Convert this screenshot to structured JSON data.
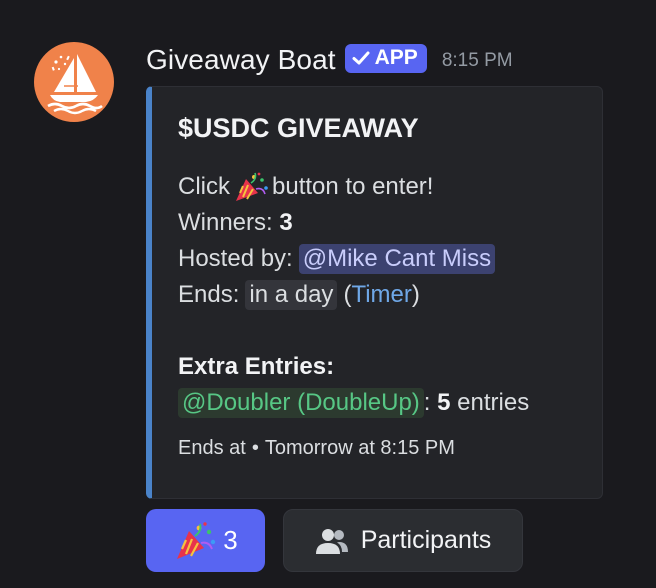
{
  "author": {
    "username": "Giveaway Boat",
    "tag": "APP",
    "timestamp": "8:15 PM",
    "avatar_icon": "sailboat-icon",
    "avatar_color": "#f0824a"
  },
  "embed": {
    "accent_color": "#4a83c9",
    "title": "$USDC GIVEAWAY",
    "click_prefix": "Click",
    "click_emoji": "party-popper-icon",
    "click_suffix": "button to enter!",
    "winners_label": "Winners:",
    "winners_value": "3",
    "hosted_label": "Hosted by:",
    "hosted_value": "@Mike Cant Miss",
    "ends_label": "Ends:",
    "ends_value": "in a day",
    "ends_paren_open": "(",
    "ends_link": "Timer",
    "ends_paren_close": ")",
    "extra_title": "Extra Entries:",
    "extra_role": "@Doubler (DoubleUp)",
    "extra_colon": ":",
    "extra_count": "5",
    "extra_suffix": "entries",
    "footer_prefix": "Ends at",
    "footer_dot": "•",
    "footer_time": "Tomorrow at 8:15 PM"
  },
  "buttons": {
    "enter_count": "3",
    "enter_icon": "party-popper-icon",
    "enter_color": "#5865f2",
    "participants_label": "Participants",
    "participants_icon": "people-icon"
  }
}
